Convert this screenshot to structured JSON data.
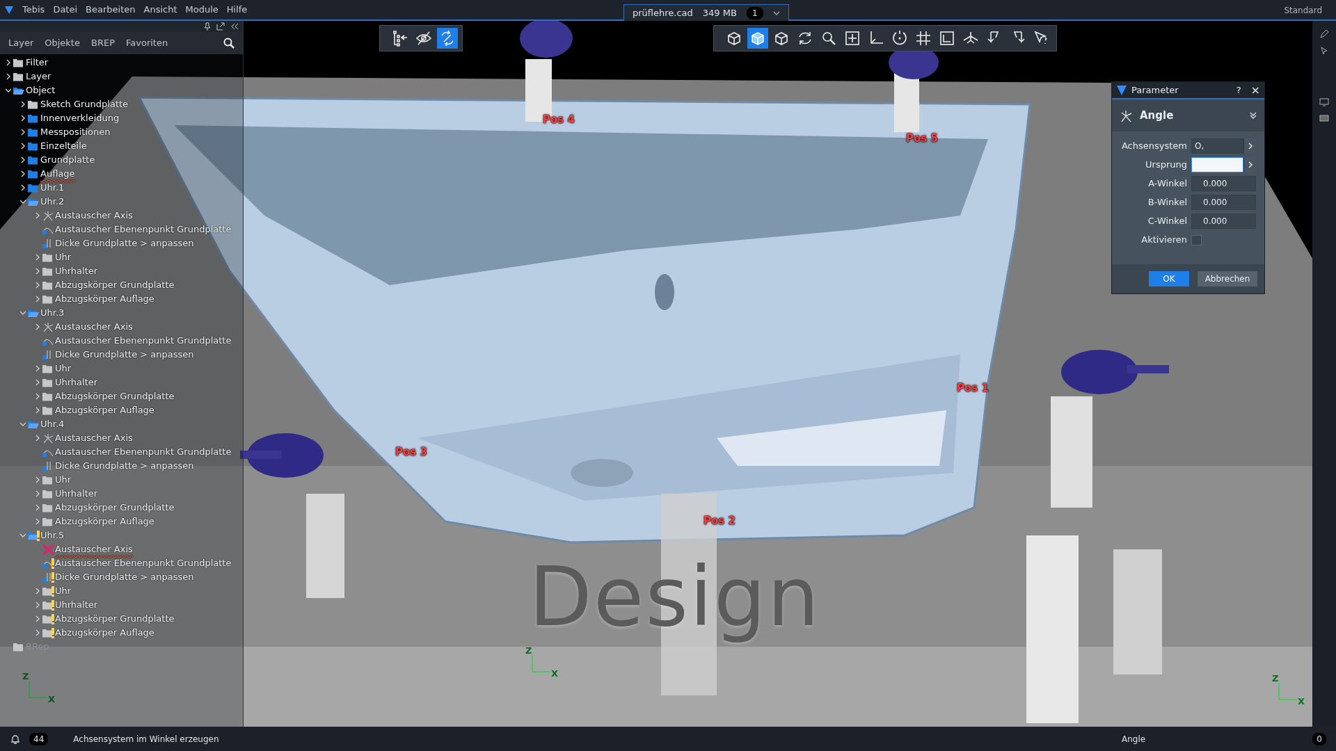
{
  "menu": [
    {
      "label": "Tebis"
    },
    {
      "label": "Datei"
    },
    {
      "label": "Bearbeiten"
    },
    {
      "label": "Ansicht"
    },
    {
      "label": "Module"
    },
    {
      "label": "Hilfe"
    }
  ],
  "document_tab": {
    "name": "prüflehre.cad",
    "size": "349 MB",
    "count": "1"
  },
  "workspace": "Standard",
  "panel": {
    "tabs": [
      {
        "label": "Layer",
        "selected": false
      },
      {
        "label": "Objekte",
        "selected": false
      },
      {
        "label": "BREP",
        "selected": false
      },
      {
        "label": "Favoriten",
        "selected": false
      }
    ],
    "tree": [
      {
        "label": "Filter",
        "kind": "folder",
        "expanded": false,
        "warning": false,
        "flagged": false,
        "disabled": false
      },
      {
        "label": "Layer",
        "kind": "folder",
        "expanded": false,
        "warning": false,
        "flagged": false,
        "disabled": false
      },
      {
        "label": "Object",
        "kind": "group",
        "expanded": true,
        "warning": false,
        "flagged": false,
        "disabled": false,
        "children": [
          {
            "label": "Sketch Grundplatte",
            "kind": "folder",
            "expanded": false,
            "warning": false,
            "flagged": false,
            "disabled": false
          },
          {
            "label": "Innenverkleidung",
            "kind": "group",
            "expanded": false,
            "warning": false,
            "flagged": false,
            "disabled": false
          },
          {
            "label": "Messpositionen",
            "kind": "group",
            "expanded": false,
            "warning": false,
            "flagged": false,
            "disabled": false
          },
          {
            "label": "Einzelteile",
            "kind": "group",
            "expanded": false,
            "warning": false,
            "flagged": false,
            "disabled": false
          },
          {
            "label": "Grundplatte",
            "kind": "group",
            "expanded": false,
            "warning": false,
            "flagged": false,
            "disabled": false
          },
          {
            "label": "Auflage",
            "kind": "group",
            "expanded": false,
            "warning": false,
            "flagged": true,
            "disabled": false
          },
          {
            "label": "Uhr.1",
            "kind": "group",
            "expanded": false,
            "warning": false,
            "flagged": false,
            "disabled": false
          },
          {
            "label": "Uhr.2",
            "kind": "group",
            "expanded": true,
            "warning": false,
            "flagged": false,
            "disabled": false,
            "children": [
              {
                "label": "Austauscher Axis",
                "kind": "axis",
                "expanded": false,
                "warning": false,
                "flagged": false,
                "disabled": false
              },
              {
                "label": "Austauscher Ebenenpunkt Grundplatte",
                "kind": "point",
                "warning": false,
                "flagged": false,
                "disabled": false
              },
              {
                "label": "Dicke Grundplatte > anpassen",
                "kind": "thickness",
                "warning": false,
                "flagged": false,
                "disabled": false
              },
              {
                "label": "Uhr",
                "kind": "folder",
                "expanded": false,
                "warning": false,
                "flagged": false,
                "disabled": false
              },
              {
                "label": "Uhrhalter",
                "kind": "folder",
                "expanded": false,
                "warning": false,
                "flagged": false,
                "disabled": false
              },
              {
                "label": "Abzugskörper Grundplatte",
                "kind": "folder",
                "expanded": false,
                "warning": false,
                "flagged": false,
                "disabled": false
              },
              {
                "label": "Abzugskörper Auflage",
                "kind": "folder",
                "expanded": false,
                "warning": false,
                "flagged": false,
                "disabled": false
              }
            ]
          },
          {
            "label": "Uhr.3",
            "kind": "group",
            "expanded": true,
            "warning": false,
            "flagged": false,
            "disabled": false,
            "children": [
              {
                "label": "Austauscher Axis",
                "kind": "axis",
                "expanded": false,
                "warning": false,
                "flagged": false,
                "disabled": false
              },
              {
                "label": "Austauscher Ebenenpunkt Grundplatte",
                "kind": "point",
                "warning": false,
                "flagged": false,
                "disabled": false
              },
              {
                "label": "Dicke Grundplatte > anpassen",
                "kind": "thickness",
                "warning": false,
                "flagged": false,
                "disabled": false
              },
              {
                "label": "Uhr",
                "kind": "folder",
                "expanded": false,
                "warning": false,
                "flagged": false,
                "disabled": false
              },
              {
                "label": "Uhrhalter",
                "kind": "folder",
                "expanded": false,
                "warning": false,
                "flagged": false,
                "disabled": false
              },
              {
                "label": "Abzugskörper Grundplatte",
                "kind": "folder",
                "expanded": false,
                "warning": false,
                "flagged": false,
                "disabled": false
              },
              {
                "label": "Abzugskörper Auflage",
                "kind": "folder",
                "expanded": false,
                "warning": false,
                "flagged": false,
                "disabled": false
              }
            ]
          },
          {
            "label": "Uhr.4",
            "kind": "group",
            "expanded": true,
            "warning": false,
            "flagged": false,
            "disabled": false,
            "children": [
              {
                "label": "Austauscher Axis",
                "kind": "axis",
                "expanded": false,
                "warning": false,
                "flagged": false,
                "disabled": false
              },
              {
                "label": "Austauscher Ebenenpunkt Grundplatte",
                "kind": "point",
                "warning": false,
                "flagged": false,
                "disabled": false
              },
              {
                "label": "Dicke Grundplatte > anpassen",
                "kind": "thickness",
                "warning": false,
                "flagged": false,
                "disabled": false
              },
              {
                "label": "Uhr",
                "kind": "folder",
                "expanded": false,
                "warning": false,
                "flagged": false,
                "disabled": false
              },
              {
                "label": "Uhrhalter",
                "kind": "folder",
                "expanded": false,
                "warning": false,
                "flagged": false,
                "disabled": false
              },
              {
                "label": "Abzugskörper Grundplatte",
                "kind": "folder",
                "expanded": false,
                "warning": false,
                "flagged": false,
                "disabled": false
              },
              {
                "label": "Abzugskörper Auflage",
                "kind": "folder",
                "expanded": false,
                "warning": false,
                "flagged": false,
                "disabled": false
              }
            ]
          },
          {
            "label": "Uhr.5",
            "kind": "group",
            "expanded": true,
            "warning": true,
            "flagged": false,
            "disabled": false,
            "children": [
              {
                "label": "Austauscher Axis",
                "kind": "error",
                "warning": false,
                "flagged": true,
                "disabled": false
              },
              {
                "label": "Austauscher Ebenenpunkt Grundplatte",
                "kind": "point",
                "warning": true,
                "flagged": false,
                "disabled": false
              },
              {
                "label": "Dicke Grundplatte > anpassen",
                "kind": "thickness",
                "warning": true,
                "flagged": false,
                "disabled": false
              },
              {
                "label": "Uhr",
                "kind": "folder",
                "expanded": false,
                "warning": true,
                "flagged": false,
                "disabled": false
              },
              {
                "label": "Uhrhalter",
                "kind": "folder",
                "expanded": false,
                "warning": true,
                "flagged": false,
                "disabled": false
              },
              {
                "label": "Abzugskörper Grundplatte",
                "kind": "folder",
                "expanded": false,
                "warning": true,
                "flagged": false,
                "disabled": false
              },
              {
                "label": "Abzugskörper Auflage",
                "kind": "folder",
                "expanded": false,
                "warning": true,
                "flagged": false,
                "disabled": false
              }
            ]
          }
        ]
      },
      {
        "label": "BRep",
        "kind": "folder",
        "warning": false,
        "flagged": false,
        "disabled": true
      }
    ]
  },
  "view_toolbar_left": [
    {
      "selected": false
    },
    {
      "selected": false
    },
    {
      "selected": true
    }
  ],
  "view_toolbar_right": [
    {
      "selected": false
    },
    {
      "selected": true
    },
    {
      "selected": false
    },
    {
      "selected": false
    },
    {
      "selected": false
    },
    {
      "selected": false
    },
    {
      "selected": false
    },
    {
      "selected": false
    },
    {
      "selected": false
    },
    {
      "selected": false
    },
    {
      "selected": false
    },
    {
      "selected": false
    },
    {
      "selected": false
    },
    {
      "selected": false
    }
  ],
  "viewport": {
    "positions": [
      {
        "label": "Pos 4"
      },
      {
        "label": "Pos 5"
      },
      {
        "label": "Pos 3"
      },
      {
        "label": "Pos 1"
      },
      {
        "label": "Pos 2"
      }
    ],
    "triads": [
      {
        "labels": [
          "Z",
          "X"
        ]
      },
      {
        "labels": [
          "Z",
          "X"
        ]
      },
      {
        "labels": [
          "Z",
          "X"
        ]
      }
    ],
    "caption": "Design"
  },
  "dialog": {
    "title": "Parameter",
    "help": "?",
    "close": "×",
    "section": "Angle",
    "fields": [
      {
        "label": "Achsensystem",
        "kind": "pick",
        "value": "O,",
        "focused": false
      },
      {
        "label": "Ursprung",
        "kind": "pick",
        "focused": true
      },
      {
        "label": "A-Winkel",
        "kind": "number",
        "value": "0.000",
        "focused": false
      },
      {
        "label": "B-Winkel",
        "kind": "number",
        "value": "0.000",
        "focused": false
      },
      {
        "label": "C-Winkel",
        "kind": "number",
        "value": "0.000",
        "focused": false
      },
      {
        "label": "Aktivieren",
        "kind": "checkbox",
        "checked": false
      }
    ],
    "ok": "OK",
    "cancel": "Abbrechen"
  },
  "status_bar": {
    "count": "44",
    "message": "Achsensystem im Winkel erzeugen",
    "mode": "Angle",
    "right_count": "0"
  }
}
